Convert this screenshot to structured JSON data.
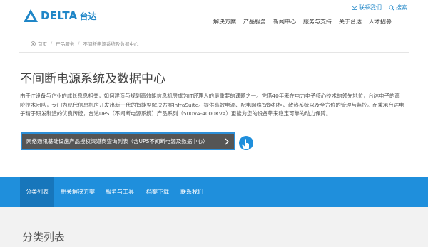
{
  "header": {
    "brand": "DELTA",
    "brand_cn": "台达",
    "util": [
      {
        "label": "联系我们"
      },
      {
        "label": "搜索"
      }
    ],
    "nav": [
      {
        "label": "解决方案"
      },
      {
        "label": "产品服务"
      },
      {
        "label": "新闻中心"
      },
      {
        "label": "服务与支持"
      },
      {
        "label": "关于台达"
      },
      {
        "label": "人才招募"
      }
    ]
  },
  "breadcrumb": [
    {
      "label": "首页"
    },
    {
      "label": "产品服务"
    },
    {
      "label": "不间断电源系统及数据中心"
    }
  ],
  "main": {
    "title": "不间断电源系统及数据中心",
    "intro": "由于IT设备与企业的成长息息相关，如何建造与规划高效能信息机房成为IT经理人的最重要的课题之一。凭借40年来在电力电子核心技术的领先地位，台达电子的高阶技术团队，专门为现代信息机房开发出新一代的智能型解决方案InfraSuite。提供高效电源、配电网络智能机柜、散热系统以及全方位的管理与监控。而秉承台达电子精于研发制造的优良传统，台达UPS（不间断电源系统）产品系列（500VA-4000KVA）更能为您的设备带来稳定可靠的动力保障。",
    "cta_label": "网络通讯基础设施产品授权渠道商查询列表（含UPS不间断电源及数据中心）"
  },
  "tabs": [
    {
      "label": "分类列表",
      "active": true
    },
    {
      "label": "相关解决方案",
      "active": false
    },
    {
      "label": "服务与工具",
      "active": false
    },
    {
      "label": "档案下载",
      "active": false
    },
    {
      "label": "联系我们",
      "active": false
    }
  ],
  "section": {
    "title": "分类列表"
  },
  "colors": {
    "brand_blue": "#1f86c7",
    "tab_bar": "#1f8fdc",
    "tab_active": "#1776bb",
    "cta_bg": "#555555",
    "cta_border": "#2d8fd8"
  },
  "icons": {
    "logo": "delta-triangle-logo",
    "contact": "envelope-icon",
    "search": "search-icon",
    "breadcrumb_home": "home-icon",
    "cta": "chevron-right-icon",
    "pointer": "hand-pointer-icon"
  }
}
